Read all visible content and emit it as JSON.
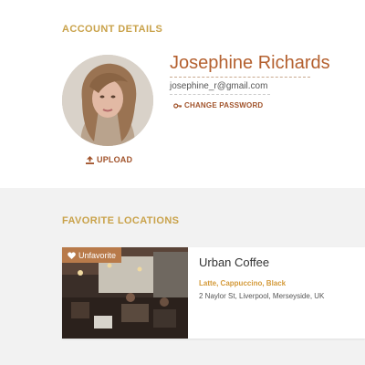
{
  "account": {
    "section_title": "ACCOUNT DETAILS",
    "name": "Josephine Richards",
    "email": "josephine_r@gmail.com",
    "change_password_label": "CHANGE PASSWORD",
    "upload_label": "UPLOAD"
  },
  "favorites": {
    "section_title": "FAVORITE LOCATIONS",
    "items": [
      {
        "badge_label": "Unfavorite",
        "name": "Urban Coffee",
        "drinks": "Latte, Cappuccino, Black",
        "address": "2 Naylor St, Liverpool, Merseyside, UK"
      }
    ]
  },
  "colors": {
    "accent_gold": "#c9a24a",
    "accent_brown": "#a1532b",
    "name_color": "#b4602f",
    "badge_bg": "#b87a4a"
  },
  "icons": {
    "upload": "upload-icon",
    "change_password": "key-icon",
    "unfavorite": "heart-icon"
  }
}
